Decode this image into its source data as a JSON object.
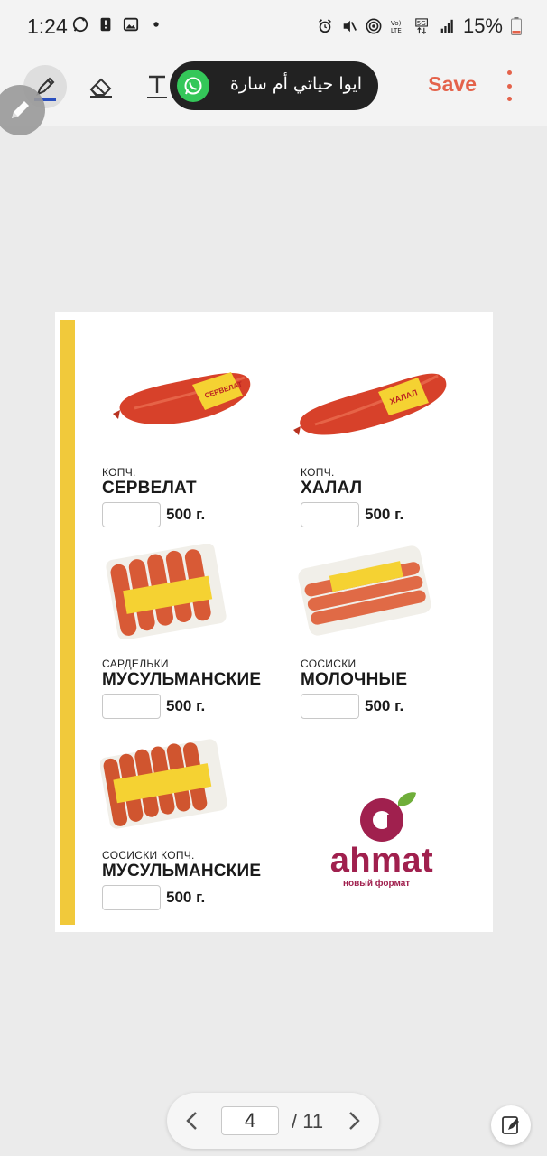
{
  "status_bar": {
    "time": "1:24",
    "battery_text": "15%"
  },
  "toolbar": {
    "save_label": "Save"
  },
  "notification": {
    "text": "ايوا   حياتي أم سارة"
  },
  "document": {
    "products": [
      {
        "sub": "КОПЧ.",
        "name": "СЕРВЕЛАТ",
        "weight": "500 г."
      },
      {
        "sub": "КОПЧ.",
        "name": "ХАЛАЛ",
        "weight": "500 г."
      },
      {
        "sub": "САРДЕЛЬКИ",
        "name": "МУСУЛЬМАНСКИЕ",
        "weight": "500 г."
      },
      {
        "sub": "СОСИСКИ",
        "name": "МОЛОЧНЫЕ",
        "weight": "500 г."
      },
      {
        "sub": "СОСИСКИ КОПЧ.",
        "name": "МУСУЛЬМАНСКИЕ",
        "weight": "500 г."
      }
    ],
    "logo": {
      "word": "ahmat",
      "tagline": "новый формат"
    }
  },
  "pager": {
    "current_page": "4",
    "total": "/ 11"
  },
  "colors": {
    "accent": "#e4624a",
    "yellow_bar": "#f1c93b",
    "brand": "#a0204e",
    "whatsapp": "#34c759"
  }
}
